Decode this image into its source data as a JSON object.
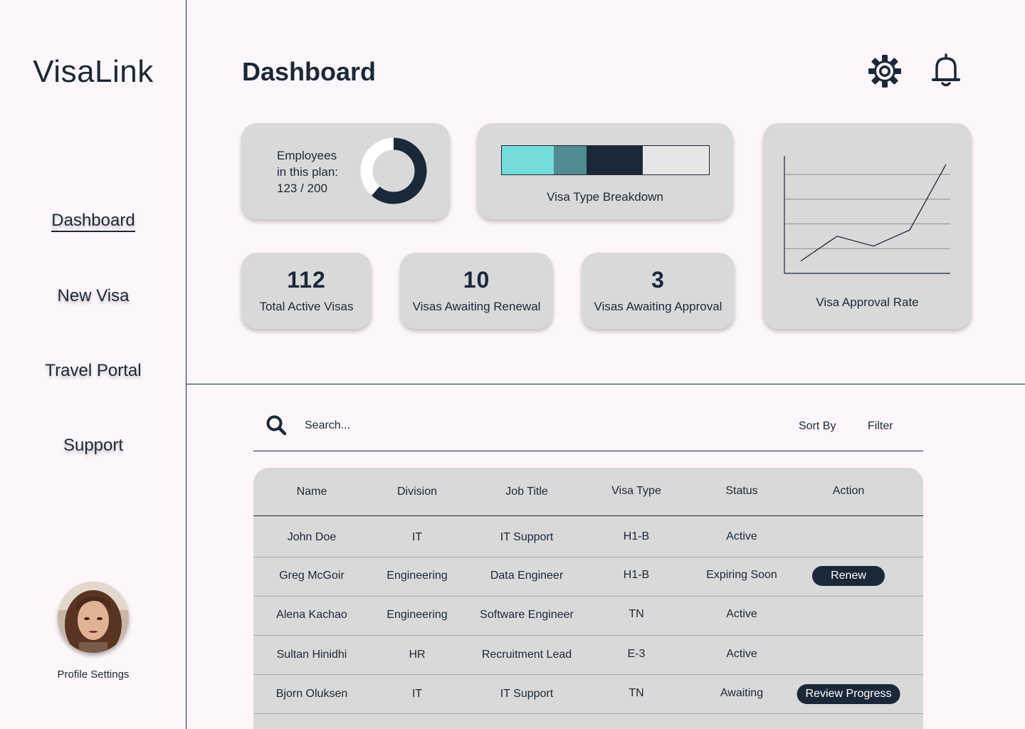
{
  "app": {
    "name": "VisaLink"
  },
  "sidebar": {
    "items": [
      {
        "label": "Dashboard",
        "active": true
      },
      {
        "label": "New Visa",
        "active": false
      },
      {
        "label": "Travel Portal",
        "active": false
      },
      {
        "label": "Support",
        "active": false
      }
    ],
    "profile_label": "Profile Settings"
  },
  "header": {
    "title": "Dashboard",
    "icons": [
      "gear-icon",
      "bell-icon"
    ]
  },
  "plan_card": {
    "line1": "Employees",
    "line2": "in this plan:",
    "line3": "123 / 200",
    "used": 123,
    "total": 200
  },
  "breakdown_card": {
    "caption": "Visa Type Breakdown",
    "segments": [
      {
        "fraction": 0.25,
        "color": "#74dcdc"
      },
      {
        "fraction": 0.16,
        "color": "#528a92"
      },
      {
        "fraction": 0.27,
        "color": "#1b2838"
      },
      {
        "fraction": 0.32,
        "color": "#e6e6e6"
      }
    ]
  },
  "stats": [
    {
      "value": "112",
      "label": "Total Active Visas"
    },
    {
      "value": "10",
      "label": "Visas Awaiting Renewal"
    },
    {
      "value": "3",
      "label": "Visas Awaiting Approval"
    }
  ],
  "chart_data": {
    "type": "line",
    "title": "Visa Approval Rate",
    "series": [
      {
        "values": [
          1,
          3,
          2.2,
          3.5,
          8.8
        ]
      }
    ],
    "ylim": [
      0,
      10
    ],
    "grid": true
  },
  "search": {
    "placeholder": "Search...",
    "sort_label": "Sort By",
    "filter_label": "Filter"
  },
  "table": {
    "columns": [
      "Name",
      "Division",
      "Job Title",
      "Visa Type",
      "Status",
      "Action"
    ],
    "rows": [
      {
        "name": "John Doe",
        "division": "IT",
        "job_title": "IT Support",
        "visa_type": "H1-B",
        "status": "Active",
        "action": ""
      },
      {
        "name": "Greg McGoir",
        "division": "Engineering",
        "job_title": "Data Engineer",
        "visa_type": "H1-B",
        "status": "Expiring Soon",
        "action": "Renew"
      },
      {
        "name": "Alena Kachao",
        "division": "Engineering",
        "job_title": "Software Engineer",
        "visa_type": "TN",
        "status": "Active",
        "action": ""
      },
      {
        "name": "Sultan Hinidhi",
        "division": "HR",
        "job_title": "Recruitment Lead",
        "visa_type": "E-3",
        "status": "Active",
        "action": ""
      },
      {
        "name": "Bjorn Oluksen",
        "division": "IT",
        "job_title": "IT Support",
        "visa_type": "TN",
        "status": "Awaiting",
        "action": "Review Progress"
      }
    ]
  },
  "colors": {
    "primary": "#1b2838",
    "card": "#d9d9d9",
    "background": "#fdf7fb",
    "teal": "#74dcdc",
    "slate_teal": "#528a92"
  }
}
